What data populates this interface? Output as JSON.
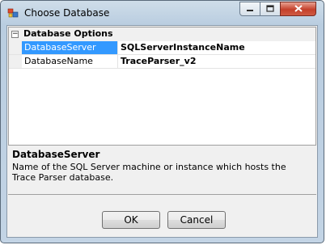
{
  "window": {
    "title": "Choose Database",
    "icons": {
      "app": "database-icon",
      "minimize": "minimize-icon",
      "maximize": "maximize-icon",
      "close": "close-icon"
    }
  },
  "grid": {
    "category": {
      "label": "Database Options",
      "expander": "⊟"
    },
    "rows": [
      {
        "name": "DatabaseServer",
        "value": "SQLServerInstanceName",
        "selected": true
      },
      {
        "name": "DatabaseName",
        "value": "TraceParser_v2",
        "selected": false
      }
    ]
  },
  "description": {
    "title": "DatabaseServer",
    "text": "Name of the SQL Server machine or instance which hosts the Trace Parser database."
  },
  "buttons": {
    "ok": "OK",
    "cancel": "Cancel"
  },
  "colors": {
    "selection": "#3399ff",
    "close_button": "#c4402a"
  }
}
